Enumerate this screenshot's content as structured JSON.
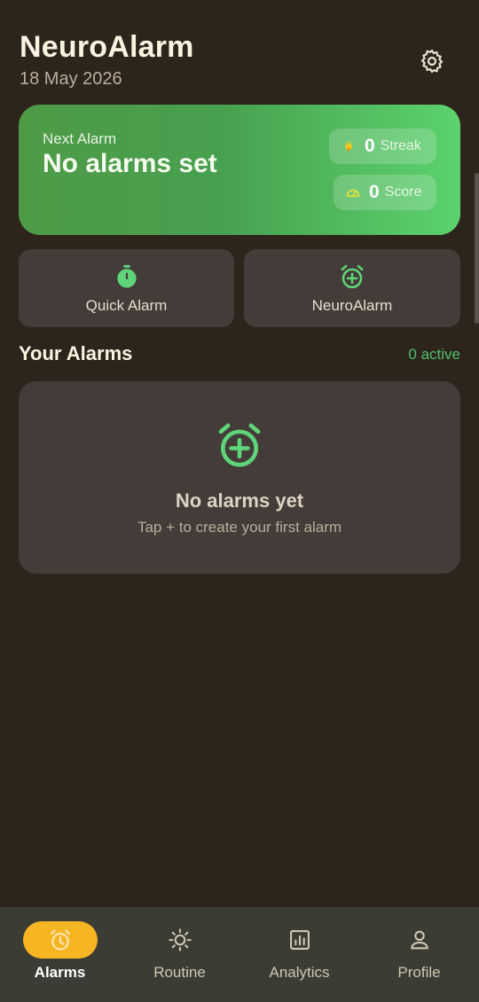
{
  "header": {
    "title": "NeuroAlarm",
    "date": "18 May 2026"
  },
  "hero": {
    "label": "Next Alarm",
    "value": "No alarms set",
    "streak": {
      "value": "0",
      "label": "Streak"
    },
    "score": {
      "value": "0",
      "label": "Score"
    }
  },
  "actions": [
    {
      "label": "Quick Alarm",
      "icon": "timer-icon"
    },
    {
      "label": "NeuroAlarm",
      "icon": "alarm-add-icon"
    }
  ],
  "alarms_section": {
    "title": "Your Alarms",
    "count": "0 active"
  },
  "empty_state": {
    "title": "No alarms yet",
    "subtitle": "Tap + to create your first alarm",
    "icon": "alarm-add-icon"
  },
  "nav": [
    {
      "label": "Alarms",
      "icon": "alarm-icon",
      "active": true
    },
    {
      "label": "Routine",
      "icon": "sun-icon",
      "active": false
    },
    {
      "label": "Analytics",
      "icon": "bar-chart-icon",
      "active": false
    },
    {
      "label": "Profile",
      "icon": "person-icon",
      "active": false
    }
  ],
  "colors": {
    "background": "#2d241c",
    "card": "#433c38",
    "accent_green": "#4fc06a",
    "nav_active": "#f6b523",
    "navbar": "#3b3c33"
  }
}
